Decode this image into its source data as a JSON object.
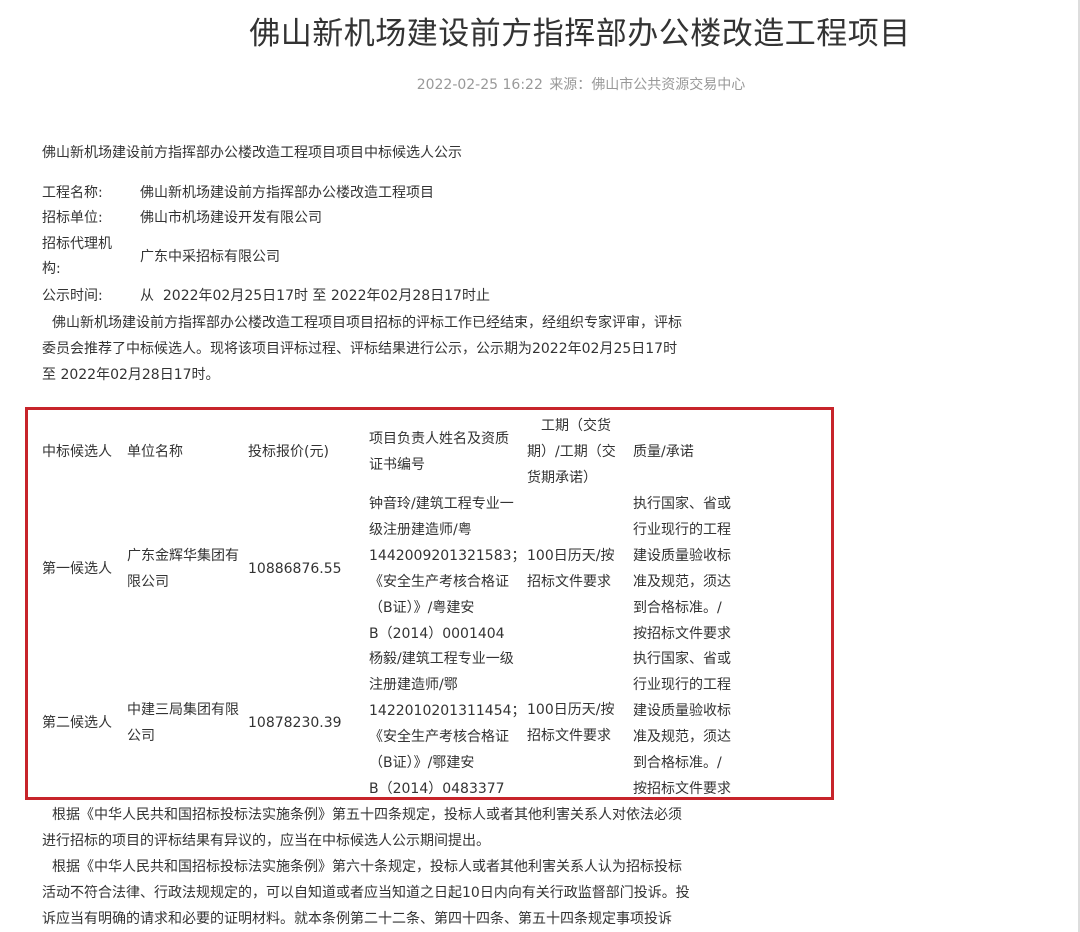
{
  "article": {
    "title": "佛山新机场建设前方指挥部办公楼改造工程项目",
    "date": "2022-02-25 16:22",
    "source_label": "来源：",
    "source": "佛山市公共资源交易中心"
  },
  "notice": {
    "heading": "佛山新机场建设前方指挥部办公楼改造工程项目项目中标候选人公示",
    "fields": {
      "project_name_label": "工程名称:",
      "project_name": "佛山新机场建设前方指挥部办公楼改造工程项目",
      "tenderer_label": "招标单位:",
      "tenderer": "佛山市机场建设开发有限公司",
      "agency_label_line1": "招标代理机",
      "agency_label_line2": "构:",
      "agency": "广东中采招标有限公司",
      "period_label": "公示时间:",
      "period": "从  2022年02月25日17时 至 2022年02月28日17时止"
    },
    "intro_lines": [
      "佛山新机场建设前方指挥部办公楼改造工程项目项目招标的评标工作已经结束，经组织专家评审，评标",
      "委员会推荐了中标候选人。现将该项目评标过程、评标结果进行公示，公示期为2022年02月25日17时",
      "至 2022年02月28日17时。"
    ]
  },
  "table": {
    "headers": {
      "candidate": "中标候选人",
      "company": "单位名称",
      "price": "投标报价(元)",
      "manager": [
        "项目负责人姓名及资质",
        "证书编号"
      ],
      "period": [
        "工期（交货",
        "期）/工期（交",
        "货期承诺）"
      ],
      "quality": "质量/承诺"
    },
    "rows": [
      {
        "candidate": "第一候选人",
        "company": [
          "广东金辉华集团有",
          "限公司"
        ],
        "price": "10886876.55",
        "manager": [
          "钟音玲/建筑工程专业一",
          "级注册建造师/粤",
          "1442009201321583；",
          "《安全生产考核合格证",
          "（B证）》/粤建安",
          "B（2014）0001404"
        ],
        "period": [
          "100日历天/按",
          "招标文件要求"
        ],
        "quality": [
          "执行国家、省或",
          "行业现行的工程",
          "建设质量验收标",
          "准及规范，须达",
          "到合格标准。/",
          "按招标文件要求"
        ]
      },
      {
        "candidate": "第二候选人",
        "company": [
          "中建三局集团有限",
          "公司"
        ],
        "price": "10878230.39",
        "manager": [
          "杨毅/建筑工程专业一级",
          "注册建造师/鄂",
          "1422010201311454；",
          "《安全生产考核合格证",
          "（B证）》/鄂建安",
          "B（2014）0483377"
        ],
        "period": [
          "100日历天/按",
          "招标文件要求"
        ],
        "quality": [
          "执行国家、省或",
          "行业现行的工程",
          "建设质量验收标",
          "准及规范，须达",
          "到合格标准。/",
          "按招标文件要求"
        ]
      }
    ]
  },
  "footer_paragraphs": [
    [
      "根据《中华人民共和国招标投标法实施条例》第五十四条规定，投标人或者其他利害关系人对依法必须",
      "进行招标的项目的评标结果有异议的，应当在中标候选人公示期间提出。"
    ],
    [
      "根据《中华人民共和国招标投标法实施条例》第六十条规定，投标人或者其他利害关系人认为招标投标",
      "活动不符合法律、行政法规规定的，可以自知道或者应当知道之日起10日内向有关行政监督部门投诉。投",
      "诉应当有明确的请求和必要的证明材料。就本条例第二十二条、第四十四条、第五十四条规定事项投诉"
    ]
  ],
  "colors": {
    "highlight_border": "#c7242a",
    "text": "#333333",
    "meta_text": "#999999"
  }
}
